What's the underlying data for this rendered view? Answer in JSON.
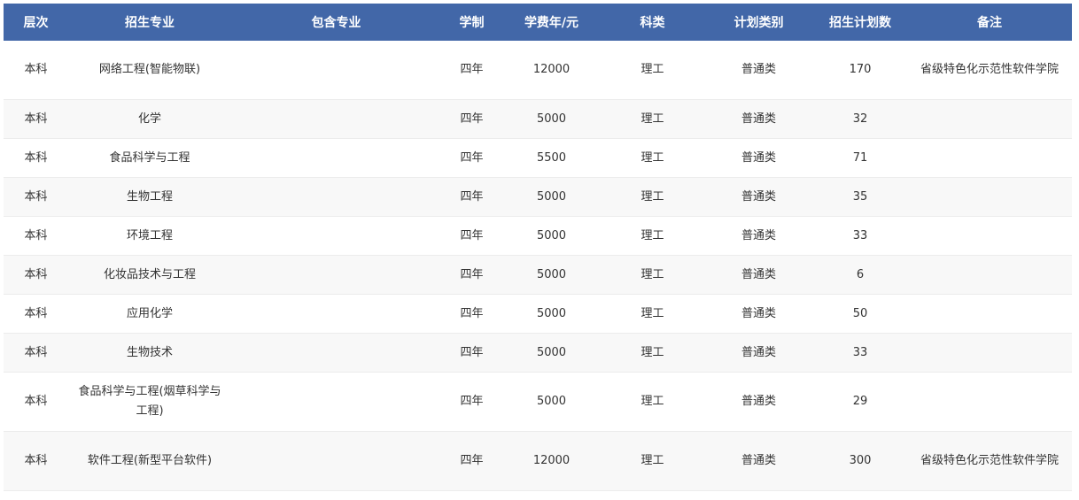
{
  "table": {
    "headers": [
      "层次",
      "招生专业",
      "包含专业",
      "学制",
      "学费年/元",
      "科类",
      "计划类别",
      "招生计划数",
      "备注"
    ],
    "rows": [
      {
        "level": "本科",
        "major": "网络工程(智能物联)",
        "included": "",
        "duration": "四年",
        "fee": "12000",
        "category": "理工",
        "plan_type": "普通类",
        "quota": "170",
        "note": "省级特色化示范性软件学院"
      },
      {
        "level": "本科",
        "major": "化学",
        "included": "",
        "duration": "四年",
        "fee": "5000",
        "category": "理工",
        "plan_type": "普通类",
        "quota": "32",
        "note": ""
      },
      {
        "level": "本科",
        "major": "食品科学与工程",
        "included": "",
        "duration": "四年",
        "fee": "5500",
        "category": "理工",
        "plan_type": "普通类",
        "quota": "71",
        "note": ""
      },
      {
        "level": "本科",
        "major": "生物工程",
        "included": "",
        "duration": "四年",
        "fee": "5000",
        "category": "理工",
        "plan_type": "普通类",
        "quota": "35",
        "note": ""
      },
      {
        "level": "本科",
        "major": "环境工程",
        "included": "",
        "duration": "四年",
        "fee": "5000",
        "category": "理工",
        "plan_type": "普通类",
        "quota": "33",
        "note": ""
      },
      {
        "level": "本科",
        "major": "化妆品技术与工程",
        "included": "",
        "duration": "四年",
        "fee": "5000",
        "category": "理工",
        "plan_type": "普通类",
        "quota": "6",
        "note": ""
      },
      {
        "level": "本科",
        "major": "应用化学",
        "included": "",
        "duration": "四年",
        "fee": "5000",
        "category": "理工",
        "plan_type": "普通类",
        "quota": "50",
        "note": ""
      },
      {
        "level": "本科",
        "major": "生物技术",
        "included": "",
        "duration": "四年",
        "fee": "5000",
        "category": "理工",
        "plan_type": "普通类",
        "quota": "33",
        "note": ""
      },
      {
        "level": "本科",
        "major": "食品科学与工程(烟草科学与工程)",
        "included": "",
        "duration": "四年",
        "fee": "5000",
        "category": "理工",
        "plan_type": "普通类",
        "quota": "29",
        "note": ""
      },
      {
        "level": "本科",
        "major": "软件工程(新型平台软件)",
        "included": "",
        "duration": "四年",
        "fee": "12000",
        "category": "理工",
        "plan_type": "普通类",
        "quota": "300",
        "note": "省级特色化示范性软件学院"
      }
    ]
  }
}
